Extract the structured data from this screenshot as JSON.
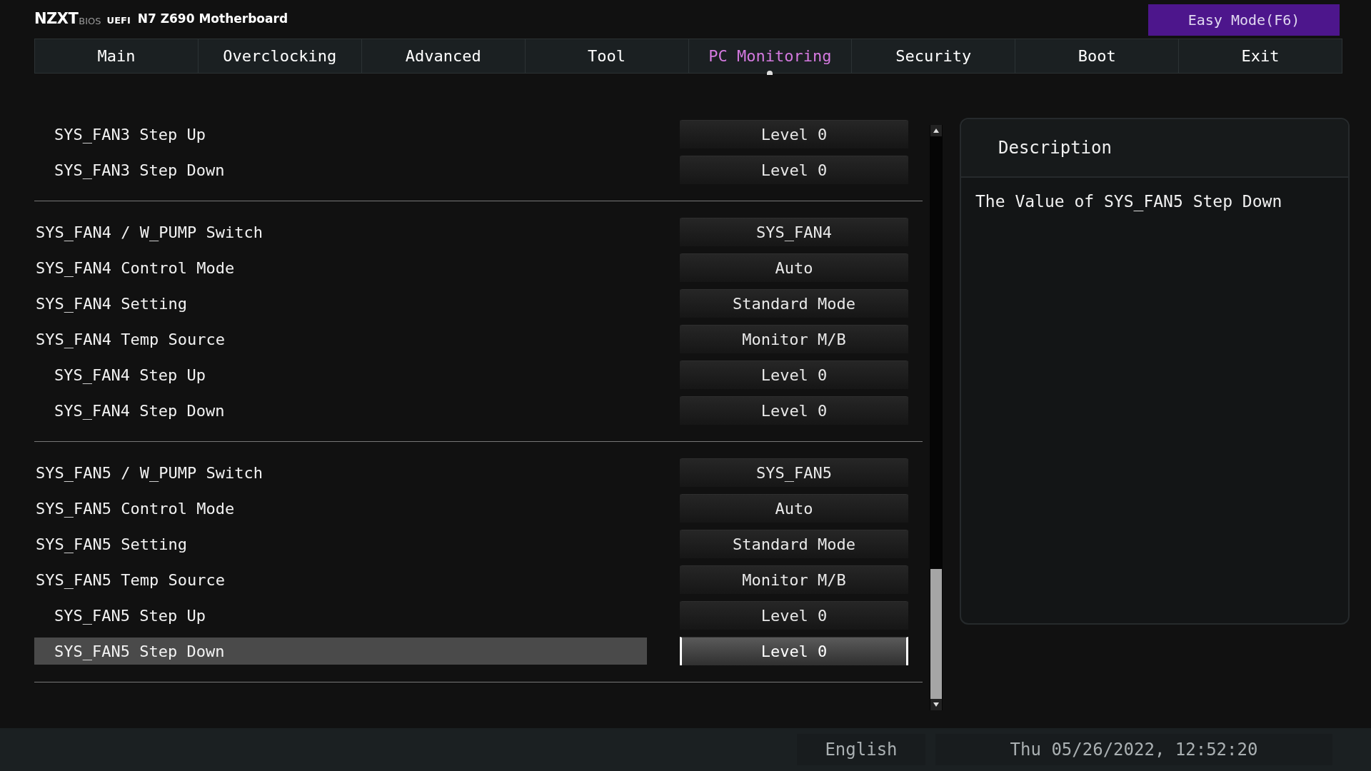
{
  "header": {
    "brand": "NZXT",
    "bios": "BIOS",
    "uefi": "UEFI",
    "model": "N7 Z690 Motherboard",
    "easy_mode": "Easy Mode(F6)"
  },
  "tabs": [
    {
      "label": "Main",
      "selected": false
    },
    {
      "label": "Overclocking",
      "selected": false
    },
    {
      "label": "Advanced",
      "selected": false
    },
    {
      "label": "Tool",
      "selected": false
    },
    {
      "label": "PC Monitoring",
      "selected": true
    },
    {
      "label": "Security",
      "selected": false
    },
    {
      "label": "Boot",
      "selected": false
    },
    {
      "label": "Exit",
      "selected": false
    }
  ],
  "settings_groups": [
    {
      "rows": [
        {
          "label": "SYS_FAN3 Step Up",
          "value": "Level 0",
          "indented": true,
          "selected": false
        },
        {
          "label": "SYS_FAN3 Step Down",
          "value": "Level 0",
          "indented": true,
          "selected": false
        }
      ]
    },
    {
      "rows": [
        {
          "label": "SYS_FAN4 / W_PUMP Switch",
          "value": "SYS_FAN4",
          "indented": false,
          "selected": false
        },
        {
          "label": "SYS_FAN4 Control Mode",
          "value": "Auto",
          "indented": false,
          "selected": false
        },
        {
          "label": "SYS_FAN4 Setting",
          "value": "Standard Mode",
          "indented": false,
          "selected": false
        },
        {
          "label": "SYS_FAN4 Temp Source",
          "value": "Monitor M/B",
          "indented": false,
          "selected": false
        },
        {
          "label": "SYS_FAN4 Step Up",
          "value": "Level 0",
          "indented": true,
          "selected": false
        },
        {
          "label": "SYS_FAN4 Step Down",
          "value": "Level 0",
          "indented": true,
          "selected": false
        }
      ]
    },
    {
      "rows": [
        {
          "label": "SYS_FAN5 / W_PUMP Switch",
          "value": "SYS_FAN5",
          "indented": false,
          "selected": false
        },
        {
          "label": "SYS_FAN5 Control Mode",
          "value": "Auto",
          "indented": false,
          "selected": false
        },
        {
          "label": "SYS_FAN5 Setting",
          "value": "Standard Mode",
          "indented": false,
          "selected": false
        },
        {
          "label": "SYS_FAN5 Temp Source",
          "value": "Monitor M/B",
          "indented": false,
          "selected": false
        },
        {
          "label": "SYS_FAN5 Step Up",
          "value": "Level 0",
          "indented": true,
          "selected": false
        },
        {
          "label": "SYS_FAN5 Step Down",
          "value": "Level 0",
          "indented": true,
          "selected": true
        }
      ]
    }
  ],
  "description": {
    "title": "Description",
    "text": "The Value of SYS_FAN5 Step Down"
  },
  "status_bar": {
    "language": "English",
    "datetime": "Thu 05/26/2022, 12:52:20"
  }
}
